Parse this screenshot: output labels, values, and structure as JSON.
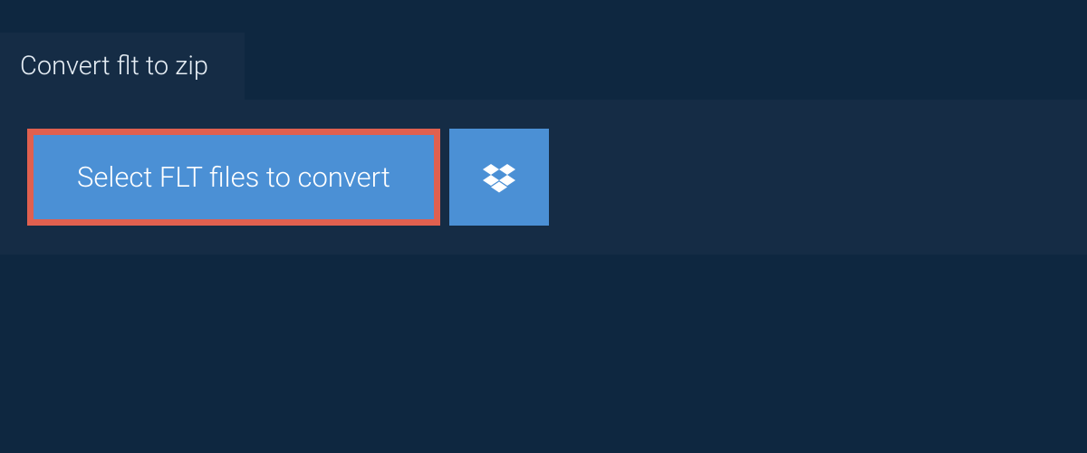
{
  "tab": {
    "label": "Convert flt to zip"
  },
  "actions": {
    "select_label": "Select FLT files to convert"
  },
  "colors": {
    "page_bg": "#0e2740",
    "panel_bg": "#152c45",
    "button_bg": "#4b90d5",
    "highlight_border": "#e0604f",
    "text_light": "#e6eef5",
    "text_white": "#ffffff"
  }
}
